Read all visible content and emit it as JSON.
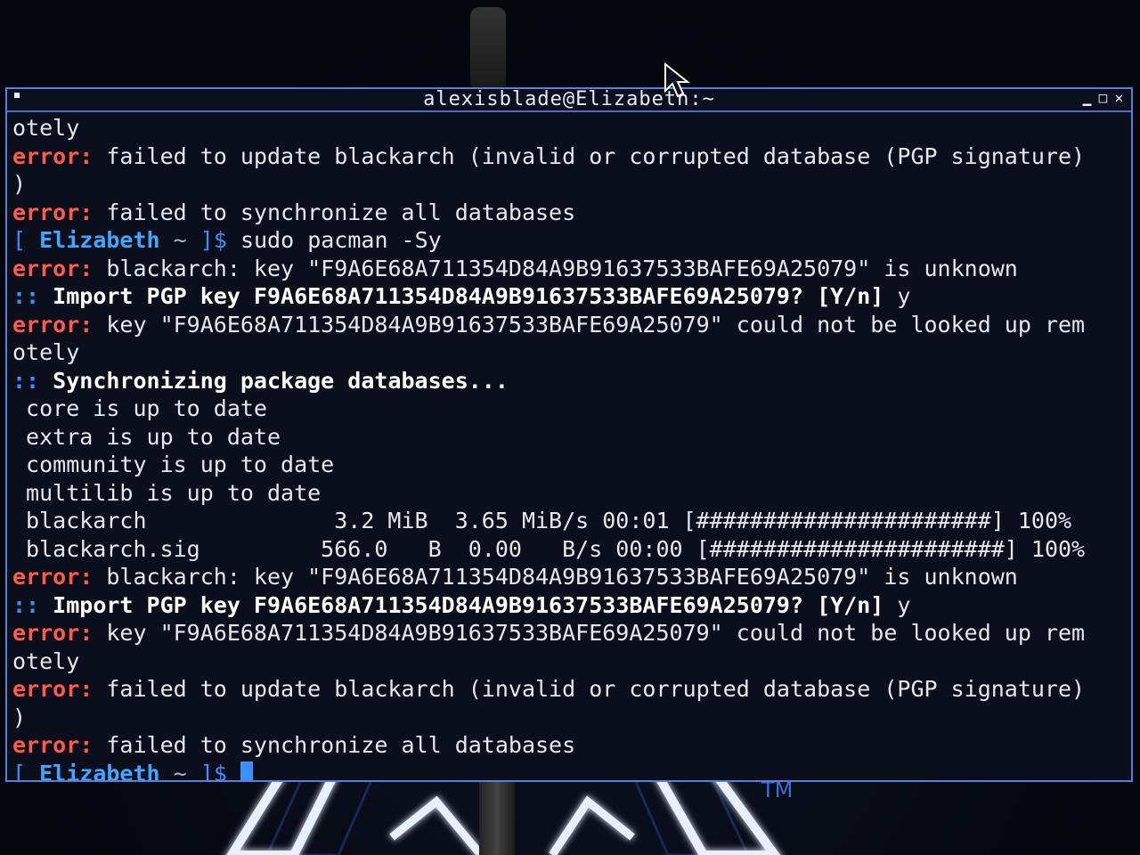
{
  "window": {
    "title": "alexisblade@Elizabeth:~"
  },
  "prompt": {
    "open": "[",
    "host": "Elizabeth",
    "dir": "~",
    "close": "]$"
  },
  "lines": [
    {
      "type": "plain",
      "text": "otely"
    },
    {
      "type": "error",
      "label": "error:",
      "text": " failed to update blackarch (invalid or corrupted database (PGP signature)"
    },
    {
      "type": "plain",
      "text": ")"
    },
    {
      "type": "error",
      "label": "error:",
      "text": " failed to synchronize all databases"
    },
    {
      "type": "prompt",
      "command": " sudo pacman -Sy"
    },
    {
      "type": "error",
      "label": "error:",
      "text": " blackarch: key \"F9A6E68A711354D84A9B91637533BAFE69A25079\" is unknown"
    },
    {
      "type": "action",
      "marker": "::",
      "bold": " Import PGP key F9A6E68A711354D84A9B91637533BAFE69A25079? [Y/n]",
      "text": " y"
    },
    {
      "type": "error",
      "label": "error:",
      "text": " key \"F9A6E68A711354D84A9B91637533BAFE69A25079\" could not be looked up rem"
    },
    {
      "type": "plain",
      "text": "otely"
    },
    {
      "type": "action",
      "marker": "::",
      "bold": " Synchronizing package databases...",
      "text": ""
    },
    {
      "type": "plain",
      "text": " core is up to date"
    },
    {
      "type": "plain",
      "text": " extra is up to date"
    },
    {
      "type": "plain",
      "text": " community is up to date"
    },
    {
      "type": "plain",
      "text": " multilib is up to date"
    },
    {
      "type": "plain",
      "text": " blackarch              3.2 MiB  3.65 MiB/s 00:01 [######################] 100%"
    },
    {
      "type": "plain",
      "text": " blackarch.sig         566.0   B  0.00   B/s 00:00 [######################] 100%"
    },
    {
      "type": "error",
      "label": "error:",
      "text": " blackarch: key \"F9A6E68A711354D84A9B91637533BAFE69A25079\" is unknown"
    },
    {
      "type": "action",
      "marker": "::",
      "bold": " Import PGP key F9A6E68A711354D84A9B91637533BAFE69A25079? [Y/n]",
      "text": " y"
    },
    {
      "type": "error",
      "label": "error:",
      "text": " key \"F9A6E68A711354D84A9B91637533BAFE69A25079\" could not be looked up rem"
    },
    {
      "type": "plain",
      "text": "otely"
    },
    {
      "type": "error",
      "label": "error:",
      "text": " failed to update blackarch (invalid or corrupted database (PGP signature)"
    },
    {
      "type": "plain",
      "text": ")"
    },
    {
      "type": "error",
      "label": "error:",
      "text": " failed to synchronize all databases"
    },
    {
      "type": "prompt",
      "command": " "
    }
  ],
  "background": {
    "trademark": "TM"
  },
  "colors": {
    "error": "#ff5a4a",
    "prompt_blue": "#3b8fff",
    "terminal_bg": "#0a0f1b",
    "border": "#5a7fd8"
  }
}
